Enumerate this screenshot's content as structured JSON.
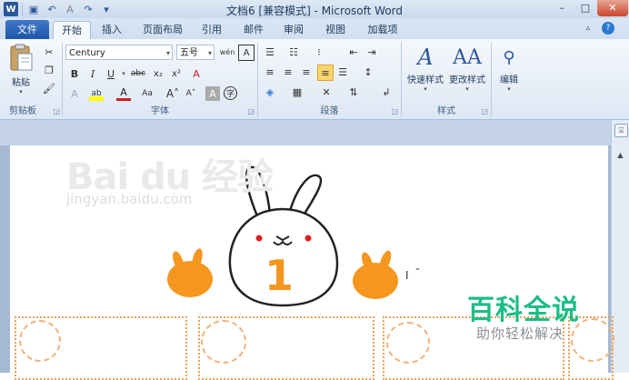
{
  "window": {
    "title": "文档6 [兼容模式] - Microsoft Word",
    "controls": {
      "minimize": "–",
      "maximize": "□",
      "close": "✕"
    }
  },
  "quick_access": [
    "word-icon",
    "save-icon",
    "undo-icon",
    "redo-icon",
    "customize-icon"
  ],
  "tabs": {
    "file": "文件",
    "items": [
      "开始",
      "插入",
      "页面布局",
      "引用",
      "邮件",
      "审阅",
      "视图",
      "加载项"
    ],
    "active": "开始"
  },
  "ribbon": {
    "clipboard": {
      "label": "剪贴板",
      "paste": "粘贴"
    },
    "font": {
      "label": "字体",
      "font_name": "Century",
      "font_size": "五号"
    },
    "paragraph": {
      "label": "段落"
    },
    "styles": {
      "label": "样式",
      "quick_styles": "快速样式",
      "change_styles": "更改样式"
    },
    "editing": {
      "label": "编辑"
    }
  },
  "document": {
    "watermark_brand": "Bai du 经验",
    "watermark_url": "jingyan.baidu.com",
    "number": "1"
  },
  "overlay_logo": {
    "main": "百科全说",
    "sub": "助你轻松解决"
  },
  "colors": {
    "accent": "#2b579a",
    "orange": "#f5961e",
    "logo_green": "#1dbd86"
  }
}
